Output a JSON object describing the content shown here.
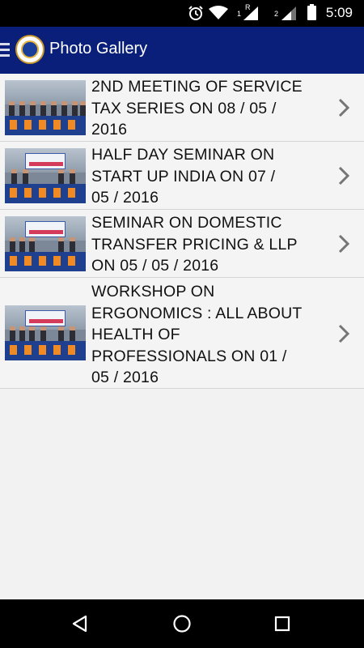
{
  "status_bar": {
    "time": "5:09",
    "sim1_label": "1",
    "sim1_roaming": "R",
    "sim2_label": "2",
    "icons": [
      "alarm-icon",
      "wifi-icon",
      "signal-icon",
      "signal-icon",
      "battery-icon"
    ]
  },
  "app_bar": {
    "title": "Photo Gallery",
    "icons": [
      "menu-icon",
      "logo-icon"
    ]
  },
  "gallery": {
    "items": [
      {
        "title_lines": [
          "2ND MEETING OF SERVICE",
          "TAX SERIES ON 08 / 05 /",
          "2016"
        ]
      },
      {
        "title_lines": [
          "HALF DAY SEMINAR ON",
          "START UP INDIA ON 07 /",
          "05 / 2016"
        ]
      },
      {
        "title_lines": [
          "SEMINAR ON DOMESTIC",
          "TRANSFER PRICING & LLP",
          "ON 05 / 05 / 2016"
        ]
      },
      {
        "title_lines": [
          "WORKSHOP ON",
          "ERGONOMICS : ALL ABOUT",
          "HEALTH OF",
          "PROFESSIONALS ON 01 /",
          "05 / 2016"
        ]
      }
    ]
  },
  "nav_bar": {
    "icons": [
      "back-icon",
      "home-icon",
      "recents-icon"
    ]
  },
  "colors": {
    "app_bar": "#0a1f7a",
    "status_bar": "#000000",
    "list_bg": "#f4f4f4",
    "divider": "#d4d4d4"
  }
}
